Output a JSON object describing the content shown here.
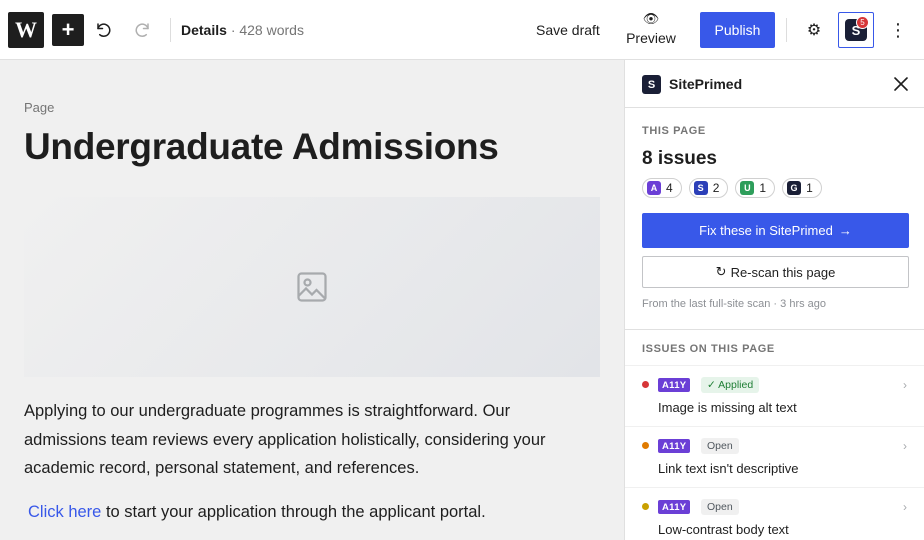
{
  "topbar": {
    "logo": "W",
    "add_label": "+",
    "doc_label": "Details",
    "doc_words": "· 428 words",
    "save_draft": "Save draft",
    "preview": "Preview",
    "publish": "Publish",
    "plugin_letter": "S",
    "plugin_badge": "5",
    "icons": [
      "wordpress-logo",
      "plus-icon",
      "undo-icon",
      "redo-icon",
      "eye-icon",
      "gear-icon",
      "more-vertical-icon"
    ]
  },
  "editor": {
    "post_type": "Page",
    "title": "Undergraduate Admissions",
    "paragraph1": "Applying to our undergraduate programmes is straightforward. Our admissions team reviews every application holistically, considering your academic record, personal statement, and references.",
    "link_text": "Click here",
    "paragraph2_rest": " to start your application through the applicant portal."
  },
  "sidebar": {
    "logo_letter": "S",
    "title": "SitePrimed",
    "this_page_label": "THIS PAGE",
    "issues_count": "8 issues",
    "chips": [
      {
        "letter": "A",
        "count": "4",
        "color": "#6b3fd6"
      },
      {
        "letter": "S",
        "count": "2",
        "color": "#2c3fb8"
      },
      {
        "letter": "U",
        "count": "1",
        "color": "#2e9e5b"
      },
      {
        "letter": "G",
        "count": "1",
        "color": "#1a1f36"
      }
    ],
    "fix_button": "Fix these in SitePrimed",
    "fix_arrow": "→",
    "rescan_icon": "↻",
    "rescan_button": "Re-scan this page",
    "scan_note": "From the last full-site scan · 3 hrs ago",
    "issues_label": "ISSUES ON THIS PAGE",
    "issues": [
      {
        "tag": "A11Y",
        "status": "✓ Applied",
        "status_type": "applied",
        "title": "Image is missing alt text",
        "dot": "#d63638"
      },
      {
        "tag": "A11Y",
        "status": "Open",
        "status_type": "open",
        "title": "Link text isn't descriptive",
        "dot": "#e07b00"
      },
      {
        "tag": "A11Y",
        "status": "Open",
        "status_type": "open",
        "title": "Low-contrast body text",
        "dot": "#c9a000"
      }
    ]
  },
  "colors": {
    "accent": "#3858e9",
    "brand_dark": "#1a1f36",
    "a11y_tag": "#6b3fd6"
  }
}
